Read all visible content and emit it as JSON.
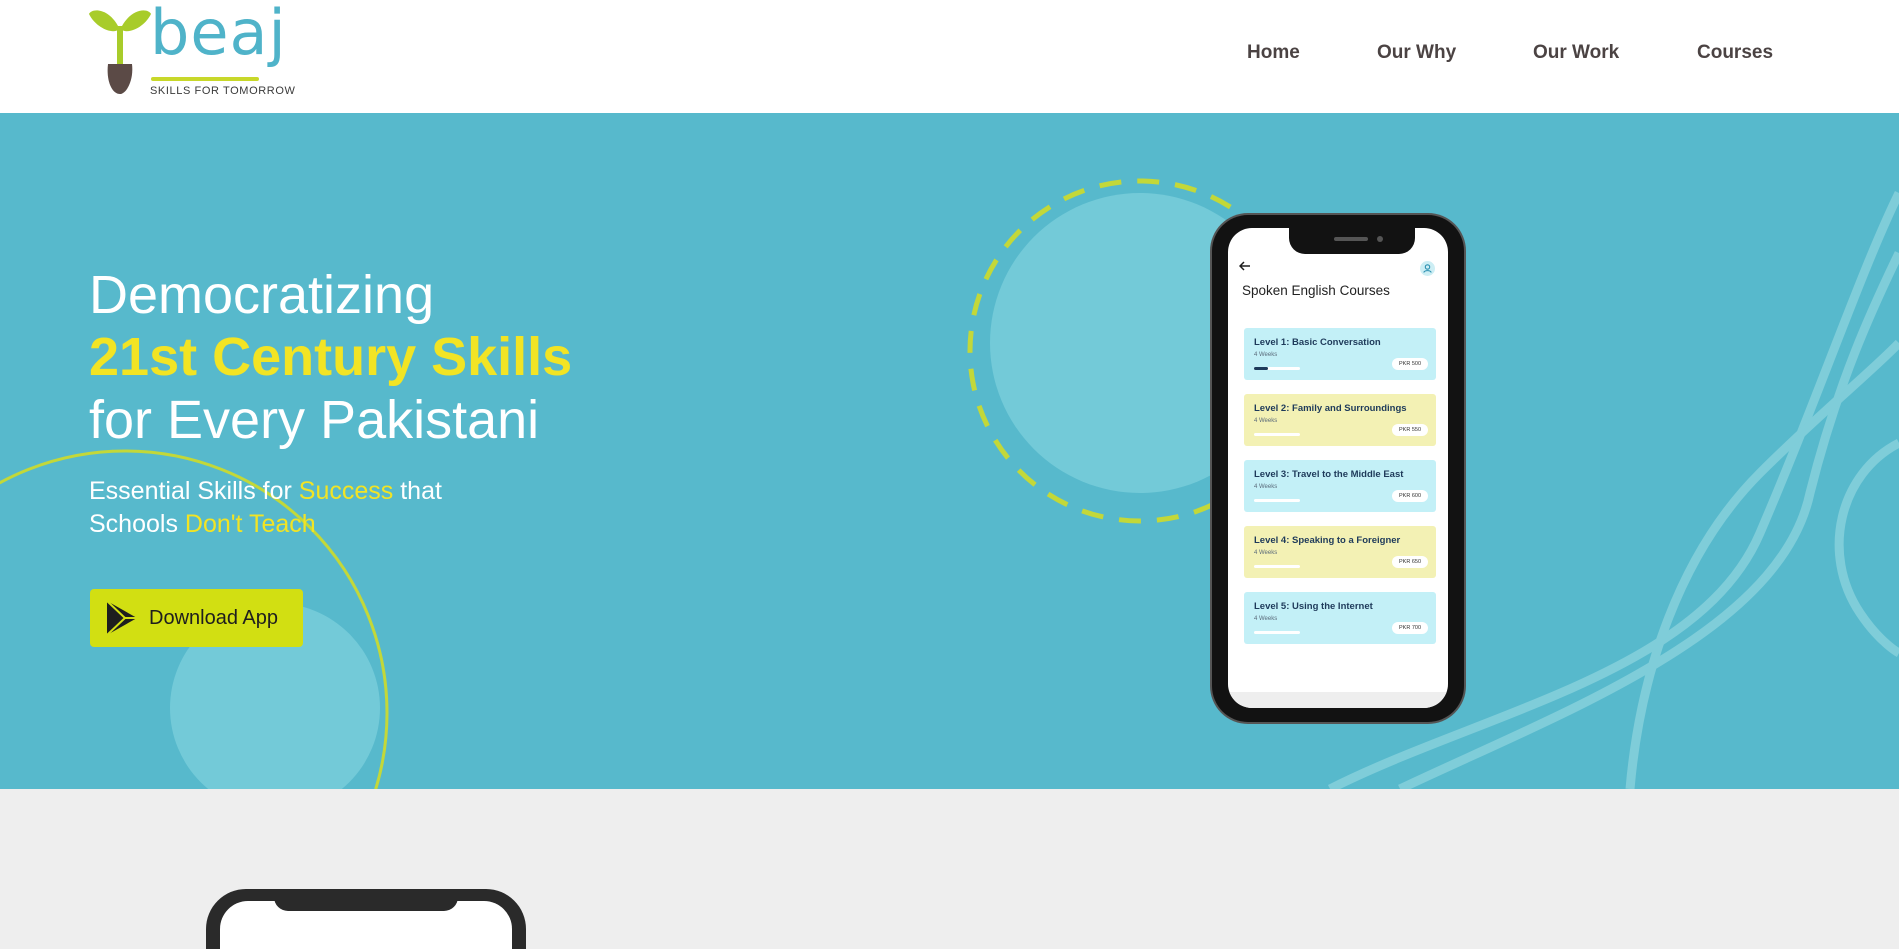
{
  "brand": {
    "logo_text": "beaj",
    "tagline": "SKILLS FOR TOMORROW",
    "colors": {
      "primary": "#57b9cc",
      "accent_yellow": "#f2e424",
      "button": "#d2df12",
      "logo_green": "#a8cc2a",
      "logo_brown": "#5b4a46"
    }
  },
  "nav": {
    "items": [
      "Home",
      "Our Why",
      "Our Work",
      "Courses"
    ]
  },
  "hero": {
    "headline_line1": "Democratizing",
    "headline_line2": "21st Century Skills",
    "headline_line3": "for Every Pakistani",
    "subtitle": {
      "part1": "Essential Skills for ",
      "highlight1": "Success",
      "part2": " that",
      "part3": "Schools ",
      "highlight2": "Don't Teach"
    },
    "cta": {
      "label": "Download App",
      "icon": "play-store-icon"
    }
  },
  "phone": {
    "back_icon": "back-arrow-icon",
    "profile_icon": "profile-icon",
    "screen_title": "Spoken English Courses",
    "courses": [
      {
        "title": "Level 1: Basic Conversation",
        "duration": "4 Weeks",
        "price": "PKR 500",
        "progress": 0.3,
        "color": "#c3f0f7"
      },
      {
        "title": "Level 2: Family and Surroundings",
        "duration": "4 Weeks",
        "price": "PKR 550",
        "progress": 0,
        "color": "#f3f1b4"
      },
      {
        "title": "Level 3: Travel to the Middle East",
        "duration": "4 Weeks",
        "price": "PKR 600",
        "progress": 0,
        "color": "#c3f0f7"
      },
      {
        "title": "Level 4: Speaking to a Foreigner",
        "duration": "4 Weeks",
        "price": "PKR 650",
        "progress": 0,
        "color": "#f3f1b4"
      },
      {
        "title": "Level 5: Using the Internet",
        "duration": "4 Weeks",
        "price": "PKR 700",
        "progress": 0,
        "color": "#c3f0f7"
      }
    ]
  }
}
